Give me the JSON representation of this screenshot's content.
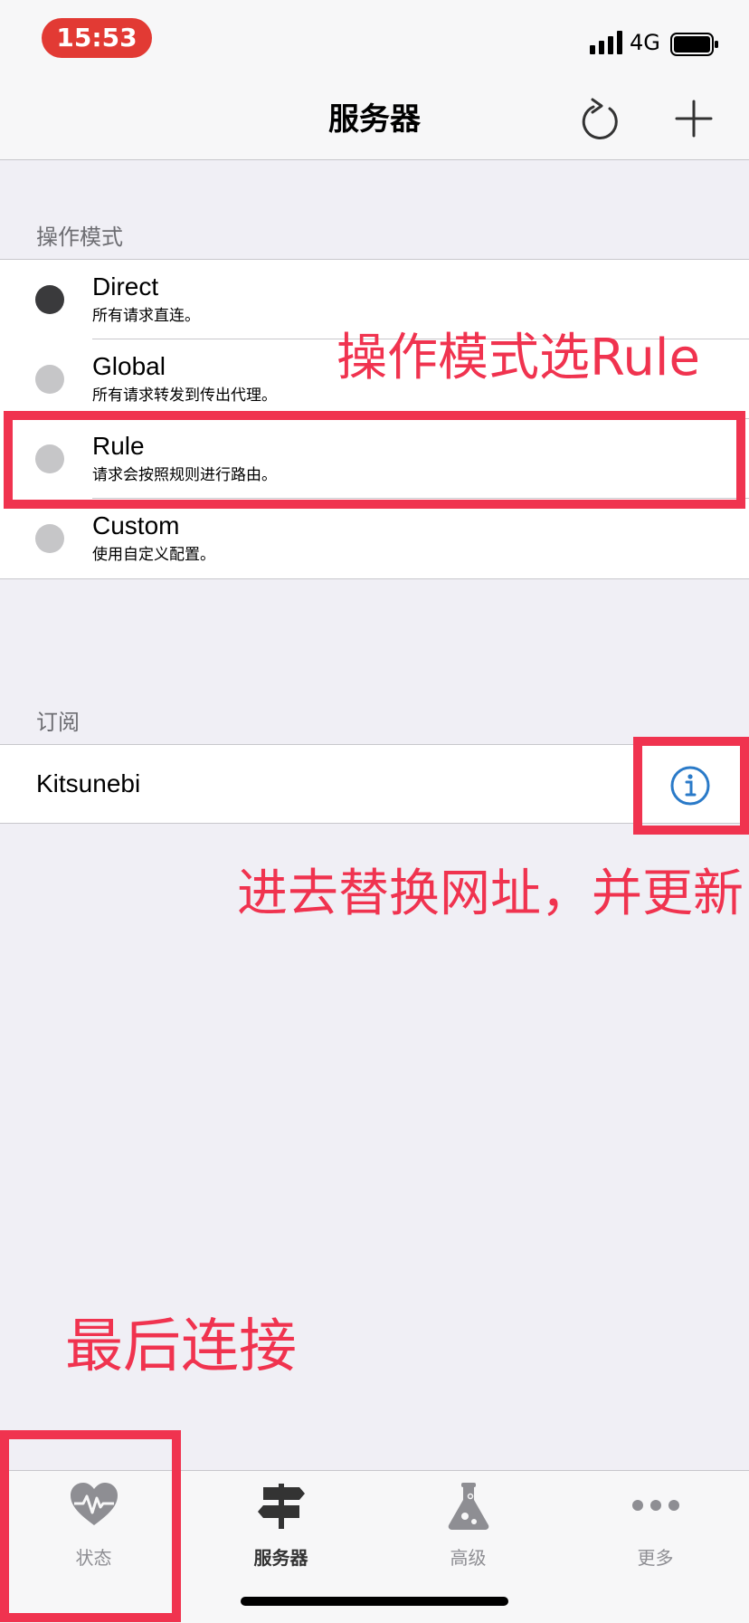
{
  "status_bar": {
    "time": "15:53",
    "network": "4G",
    "icons": [
      "signal-icon",
      "battery-icon"
    ]
  },
  "nav": {
    "title": "服务器",
    "icons": [
      "refresh-icon",
      "add-icon"
    ]
  },
  "modes": {
    "header": "操作模式",
    "selected": "Direct",
    "items": [
      {
        "title": "Direct",
        "subtitle": "所有请求直连。"
      },
      {
        "title": "Global",
        "subtitle": "所有请求转发到传出代理。"
      },
      {
        "title": "Rule",
        "subtitle": "请求会按照规则进行路由。"
      },
      {
        "title": "Custom",
        "subtitle": "使用自定义配置。"
      }
    ]
  },
  "subscriptions": {
    "header": "订阅",
    "items": [
      {
        "name": "Kitsunebi",
        "icon": "info-icon"
      }
    ]
  },
  "annotations": {
    "rule_note": "操作模式选Rule",
    "subscription_note": "进去替换网址，并更新",
    "connect_note": "最后连接",
    "color": "#f0334f"
  },
  "tabs": [
    {
      "label": "状态",
      "icon": "heartbeat-icon",
      "active": false
    },
    {
      "label": "服务器",
      "icon": "signpost-icon",
      "active": true
    },
    {
      "label": "高级",
      "icon": "flask-icon",
      "active": false
    },
    {
      "label": "更多",
      "icon": "more-dots-icon",
      "active": false
    }
  ],
  "colors": {
    "background": "#f0eff5",
    "bar": "#f7f7f8",
    "time_pill": "#e23a34",
    "selected_dot": "#3a3a3c",
    "unselected_dot": "#c6c6c8",
    "info_icon": "#2a7ac8"
  }
}
